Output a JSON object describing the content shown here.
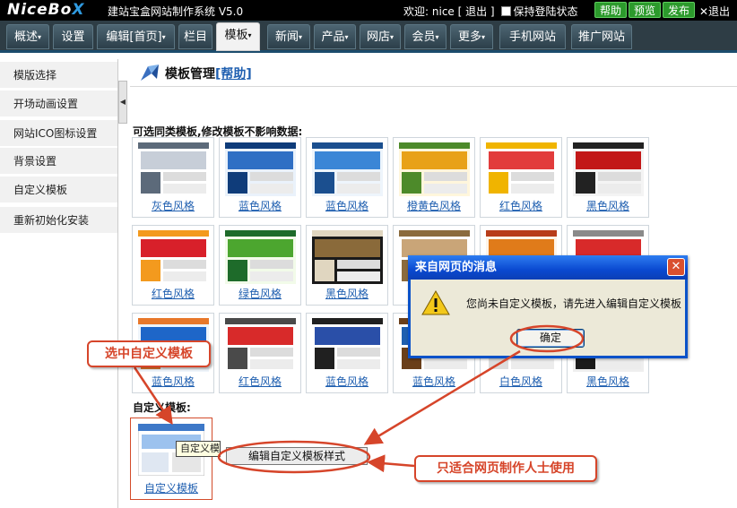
{
  "topbar": {
    "logo_main": "NiceBo",
    "logo_x": "X",
    "system_title": "建站宝盒网站制作系统 V5.0",
    "welcome_prefix": "欢迎:",
    "username": "nice",
    "logout": "[ 退出 ]",
    "remember_login": "保持登陆状态",
    "help_button": "帮助",
    "preview_button": "预览",
    "publish_button": "发布",
    "exit_label": "✕退出"
  },
  "menu": {
    "tabs": [
      {
        "label": "概述",
        "has_caret": true
      },
      {
        "label": "设置",
        "has_caret": false
      },
      {
        "label": "编辑[首页]",
        "has_caret": true
      },
      {
        "label": "栏目",
        "has_caret": false
      },
      {
        "label": "模板",
        "has_caret": true,
        "active": true
      },
      {
        "label": "新闻",
        "has_caret": true
      },
      {
        "label": "产品",
        "has_caret": true
      },
      {
        "label": "网店",
        "has_caret": true
      },
      {
        "label": "会员",
        "has_caret": true
      },
      {
        "label": "更多",
        "has_caret": true
      },
      {
        "label": "手机网站",
        "has_caret": false
      },
      {
        "label": "推广网站",
        "has_caret": false
      }
    ],
    "caret": "▾"
  },
  "sidebar": {
    "items": [
      {
        "label": "模版选择"
      },
      {
        "label": "开场动画设置"
      },
      {
        "label": "网站ICO图标设置"
      },
      {
        "label": "背景设置"
      },
      {
        "label": "自定义模板"
      },
      {
        "label": "重新初始化安装"
      }
    ],
    "toggle_glyph": "◀"
  },
  "main": {
    "title": "模板管理",
    "help_link": "[帮助]",
    "section_label": "可选同类模板,修改模板不影响数据:",
    "templates": [
      {
        "name": "灰色风格",
        "palette": [
          "#ffffff",
          "#c7ced8",
          "#5c6a7a"
        ]
      },
      {
        "name": "蓝色风格",
        "palette": [
          "#eaf2fb",
          "#2f6fc4",
          "#0f3c7a"
        ]
      },
      {
        "name": "蓝色风格",
        "palette": [
          "#eef5fc",
          "#3b86d6",
          "#1b4f8f"
        ]
      },
      {
        "name": "橙黄色风格",
        "palette": [
          "#fff6dc",
          "#e8a118",
          "#4d8a2a"
        ]
      },
      {
        "name": "红色风格",
        "palette": [
          "#ffffff",
          "#e23c3c",
          "#f0b400"
        ]
      },
      {
        "name": "黑色风格",
        "palette": [
          "#f4f4f4",
          "#c21818",
          "#222222"
        ]
      },
      {
        "name": "红色风格",
        "palette": [
          "#ffffff",
          "#d8202a",
          "#f39a1e"
        ]
      },
      {
        "name": "绿色风格",
        "palette": [
          "#f2fbe9",
          "#4ca62f",
          "#1e6b2a"
        ]
      },
      {
        "name": "黑色风格",
        "palette": [
          "#1a1a1a",
          "#8a6a3a",
          "#e0d6c0"
        ]
      },
      {
        "name": "",
        "palette": [
          "#ffffff",
          "#c9a578",
          "#8b6b3d"
        ]
      },
      {
        "name": "",
        "palette": [
          "#fff4e8",
          "#e07b1a",
          "#b83d1a"
        ]
      },
      {
        "name": "",
        "palette": [
          "#ffffff",
          "#d82a2a",
          "#8a8a8a"
        ]
      },
      {
        "name": "蓝色风格",
        "palette": [
          "#eef4fb",
          "#1e66c8",
          "#e8782a"
        ]
      },
      {
        "name": "红色风格",
        "palette": [
          "#ffffff",
          "#d82a2a",
          "#4a4a4a"
        ]
      },
      {
        "name": "蓝色风格",
        "palette": [
          "#ffffff",
          "#2a4fa8",
          "#202020"
        ]
      },
      {
        "name": "蓝色风格",
        "palette": [
          "#ffffff",
          "#1e5fb0",
          "#6a3f1a"
        ]
      },
      {
        "name": "白色风格",
        "palette": [
          "#ffffff",
          "#4a7bbf",
          "#dddddd"
        ]
      },
      {
        "name": "黑色风格",
        "palette": [
          "#eeeeee",
          "#3a3a3a",
          "#1a1a1a"
        ]
      }
    ],
    "custom_label": "自定义模板:",
    "custom_template": {
      "name": "自定义模板",
      "palette": [
        "#ffffff",
        "#3d78c8",
        "#cccccc"
      ]
    },
    "tooltip": "自定义模板",
    "edit_button": "编辑自定义模板样式"
  },
  "dialog": {
    "title": "来自网页的消息",
    "close": "✕",
    "message": "您尚未自定义模板，请先进入编辑自定义模板",
    "ok_button": "确定"
  },
  "annotations": {
    "select_custom": "选中自定义模板",
    "for_designers": "只适合网页制作人士使用",
    "color": "#d6452a"
  }
}
